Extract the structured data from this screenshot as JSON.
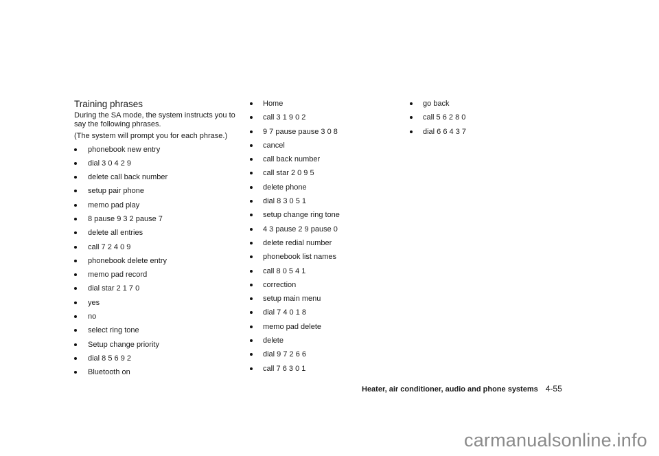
{
  "section": {
    "title": "Training phrases",
    "intro": "During the SA mode, the system instructs you to say the following phrases.",
    "note": "(The system will prompt you for each phrase.)"
  },
  "columns": [
    [
      "phonebook new entry",
      "dial 3 0 4 2 9",
      "delete call back number",
      "setup pair phone",
      "memo pad play",
      "8 pause 9 3 2 pause 7",
      "delete all entries",
      "call 7 2 4 0 9",
      "phonebook delete entry",
      "memo pad record",
      "dial star 2 1 7 0",
      "yes",
      "no",
      "select ring tone",
      "Setup change priority",
      "dial 8 5 6 9 2",
      "Bluetooth on"
    ],
    [
      "Home",
      "call 3 1 9 0 2",
      "9 7 pause pause 3 0 8",
      "cancel",
      "call back number",
      "call star 2 0 9 5",
      "delete phone",
      "dial 8 3 0 5 1",
      "setup change ring tone",
      "4 3 pause 2 9 pause 0",
      "delete redial number",
      "phonebook list names",
      "call 8 0 5 4 1",
      "correction",
      "setup main menu",
      "dial 7 4 0 1 8",
      "memo pad delete",
      "delete",
      "dial 9 7 2 6 6",
      "call 7 6 3 0 1"
    ],
    [
      "go back",
      "call 5 6 2 8 0",
      "dial 6 6 4 3 7"
    ]
  ],
  "footer": {
    "section_name": "Heater, air conditioner, audio and phone systems",
    "page_number": "4-55"
  },
  "watermark": "carmanualsonline.info"
}
